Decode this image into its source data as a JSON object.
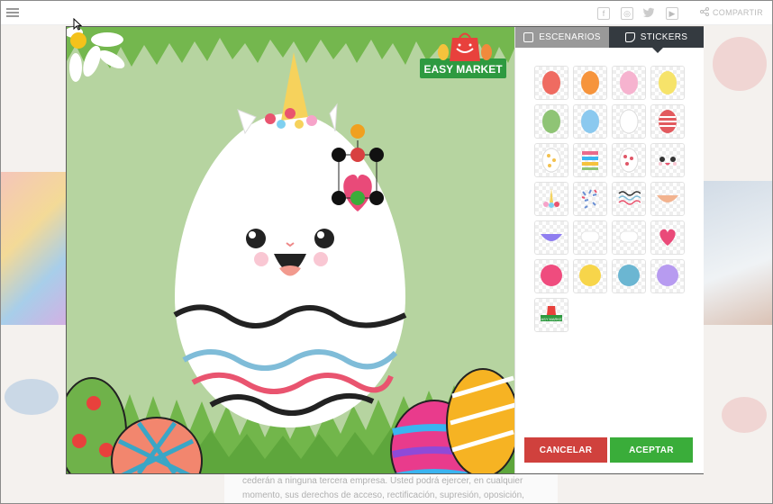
{
  "topbar": {
    "share_label": "COMPARTIR",
    "social_icons": [
      "facebook-icon",
      "instagram-icon",
      "twitter-icon",
      "youtube-icon"
    ]
  },
  "background_text": {
    "line1": "cederán a ninguna tercera empresa. Usted podrá ejercer, en cualquier",
    "line2": "momento, sus derechos de acceso, rectificación, supresión, oposición,"
  },
  "editor": {
    "tabs": [
      {
        "label": "ESCENARIOS",
        "active": false
      },
      {
        "label": "STICKERS",
        "active": true
      }
    ],
    "logo": {
      "text": "EASY MARKET"
    },
    "stickers": [
      {
        "name": "egg-red",
        "color": "#ef6b61"
      },
      {
        "name": "egg-orange",
        "color": "#f6943c"
      },
      {
        "name": "egg-pink",
        "color": "#f6b3cf"
      },
      {
        "name": "egg-yellow",
        "color": "#f6e36a"
      },
      {
        "name": "egg-green",
        "color": "#8fc475"
      },
      {
        "name": "egg-blue",
        "color": "#8bc9ef"
      },
      {
        "name": "egg-white",
        "color": "#ffffff"
      },
      {
        "name": "egg-striped-red",
        "color": "#e25a5e"
      },
      {
        "name": "egg-dots-yellow",
        "color": "#f2c14e"
      },
      {
        "name": "egg-stripes-multi",
        "color": "#e96a8b"
      },
      {
        "name": "egg-hearts",
        "color": "#e05667"
      },
      {
        "name": "bunny-face",
        "color": "#333333"
      },
      {
        "name": "unicorn-horn",
        "color": "#f4d35e"
      },
      {
        "name": "sprinkles",
        "color": "#6a8fd3"
      },
      {
        "name": "waves",
        "color": "#333333"
      },
      {
        "name": "half-peach",
        "color": "#f2b38f"
      },
      {
        "name": "half-purple",
        "color": "#8f7ef0"
      },
      {
        "name": "cloud-white",
        "color": "#ffffff"
      },
      {
        "name": "cloud-white-2",
        "color": "#ffffff"
      },
      {
        "name": "heart",
        "color": "#ea4a79"
      },
      {
        "name": "circle-pink",
        "color": "#ef4c7e"
      },
      {
        "name": "circle-yellow",
        "color": "#f7d54a"
      },
      {
        "name": "circle-blue",
        "color": "#6bb6d2"
      },
      {
        "name": "circle-purple",
        "color": "#b79bf0"
      },
      {
        "name": "logo-easy-market",
        "color": "#2e9a40"
      }
    ],
    "buttons": {
      "cancel": "CANCELAR",
      "accept": "ACEPTAR"
    },
    "colors": {
      "canvas_bg": "#b6d4a0",
      "grass": "#6fb24a",
      "cancel": "#d0413d",
      "accept": "#3aad3a",
      "tab_active": "#343a40",
      "tab_inactive": "#999999"
    }
  }
}
